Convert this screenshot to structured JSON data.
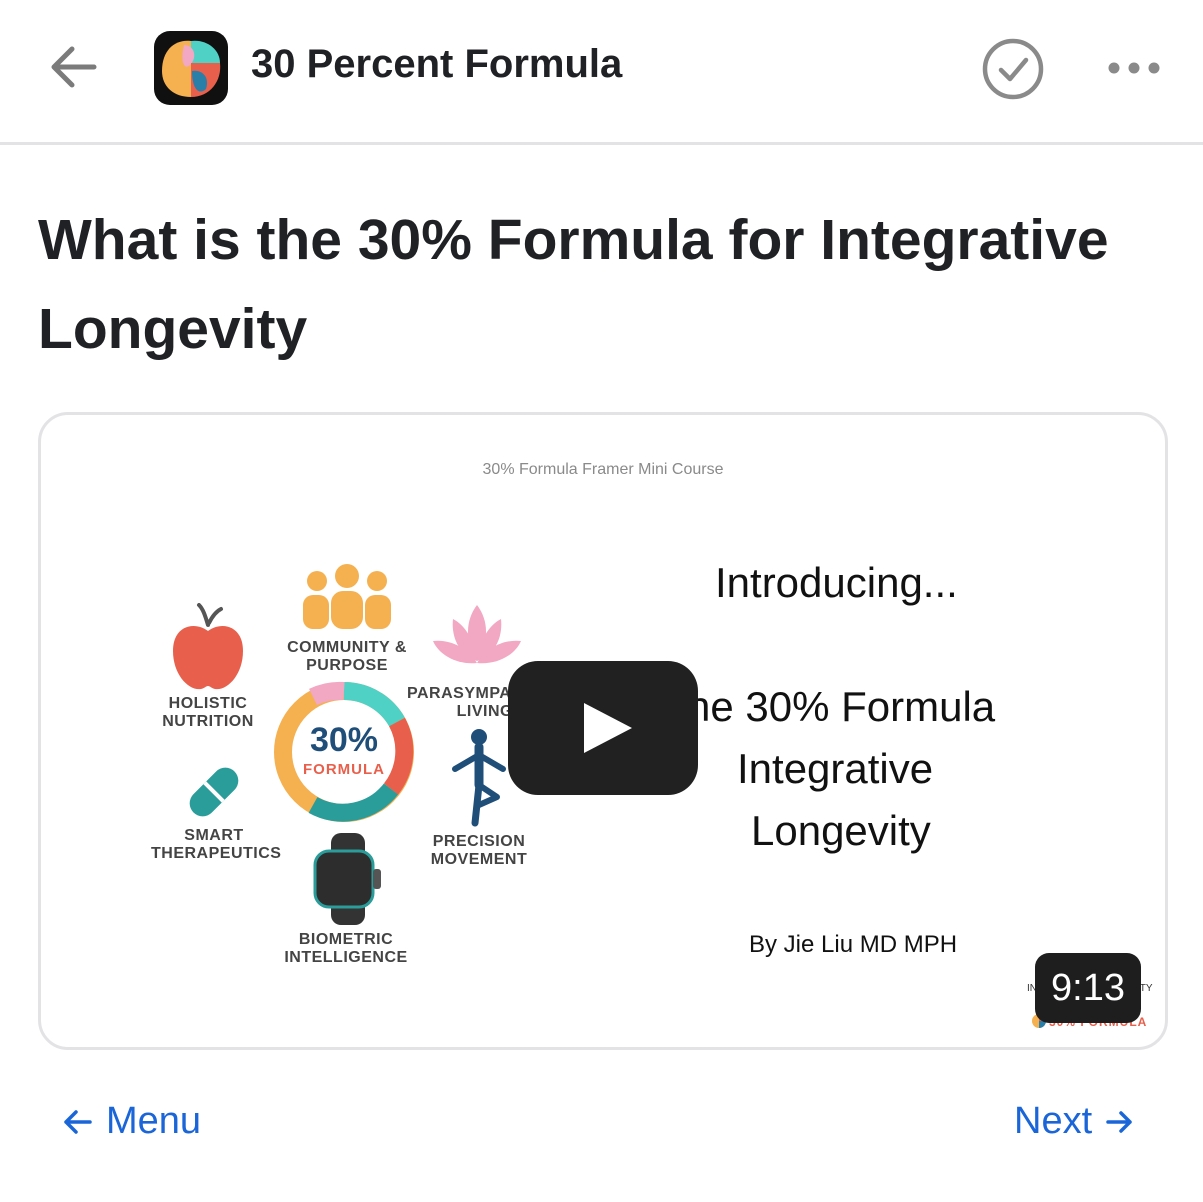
{
  "header": {
    "app_title": "30 Percent Formula",
    "icons": [
      "back-arrow-icon",
      "app-logo",
      "checkmark-circle-icon",
      "more-dots-icon"
    ]
  },
  "page": {
    "title": "What is the 30% Formula for Integrative Longevity"
  },
  "video": {
    "slide_caption": "30% Formula Framer Mini Course",
    "wheel_top": "30%",
    "wheel_bottom": "FORMULA",
    "labels": {
      "community": "COMMUNITY & PURPOSE",
      "parasympathetic": "PARASYMPATH LIVING",
      "nutrition": "HOLISTIC NUTRITION",
      "therapeutics": "SMART THERAPEUTICS",
      "movement": "PRECISION MOVEMENT",
      "biometric": "BIOMETRIC INTELLIGENCE"
    },
    "intro": "Introducing...",
    "line1": "he 30% Formula",
    "line2": "Integrative",
    "line3": "Longevity",
    "byline": "By  Jie Liu MD MPH",
    "duration": "9:13",
    "corner_left": "IN",
    "corner_right": "ITY",
    "corner_brand": "30% FORMULA",
    "icons": [
      "play-icon",
      "apple-icon",
      "people-icon",
      "lotus-icon",
      "pill-icon",
      "yoga-figure-icon",
      "smartwatch-icon"
    ]
  },
  "nav": {
    "menu_label": "Menu",
    "next_label": "Next"
  },
  "colors": {
    "link_blue": "#1a66d8",
    "text_dark": "#202124",
    "wheel_orange": "#f5b04f",
    "wheel_teal": "#2a9d9a",
    "wheel_red": "#e8604c",
    "wheel_pink": "#f2a7c3"
  }
}
